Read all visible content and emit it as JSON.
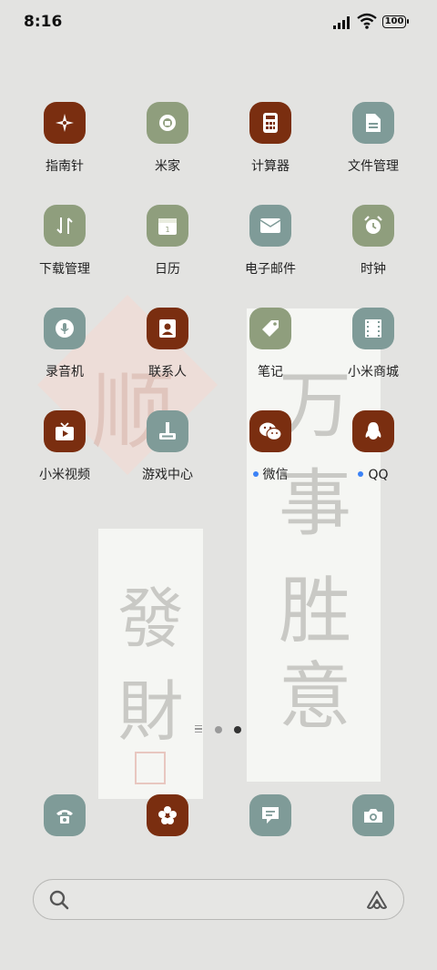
{
  "status_bar": {
    "time": "8:16",
    "battery": "100"
  },
  "wallpaper": {
    "diamond_char": "顺",
    "scroll_right_chars": [
      "万",
      "事",
      "胜",
      "意"
    ],
    "scroll_left_chars": [
      "發",
      "財"
    ]
  },
  "apps": [
    {
      "label": "指南针",
      "icon": "compass-icon",
      "color": "#7a2e10",
      "dot": false
    },
    {
      "label": "米家",
      "icon": "mijia-icon",
      "color": "#8f9e7d",
      "dot": false
    },
    {
      "label": "计算器",
      "icon": "calculator-icon",
      "color": "#7a2e10",
      "dot": false
    },
    {
      "label": "文件管理",
      "icon": "file-icon",
      "color": "#7f9b98",
      "dot": false
    },
    {
      "label": "下载管理",
      "icon": "download-icon",
      "color": "#8f9e7d",
      "dot": false
    },
    {
      "label": "日历",
      "icon": "calendar-icon",
      "color": "#8f9e7d",
      "dot": false
    },
    {
      "label": "电子邮件",
      "icon": "mail-icon",
      "color": "#7f9b98",
      "dot": false
    },
    {
      "label": "时钟",
      "icon": "alarm-clock-icon",
      "color": "#8f9e7d",
      "dot": false
    },
    {
      "label": "录音机",
      "icon": "microphone-icon",
      "color": "#7f9b98",
      "dot": false
    },
    {
      "label": "联系人",
      "icon": "contacts-icon",
      "color": "#7a2e10",
      "dot": false
    },
    {
      "label": "笔记",
      "icon": "tag-icon",
      "color": "#8f9e7d",
      "dot": false
    },
    {
      "label": "小米商城",
      "icon": "film-store-icon",
      "color": "#7f9b98",
      "dot": false
    },
    {
      "label": "小米视频",
      "icon": "tv-icon",
      "color": "#7a2e10",
      "dot": false
    },
    {
      "label": "游戏中心",
      "icon": "joystick-icon",
      "color": "#7f9b98",
      "dot": false
    },
    {
      "label": "微信",
      "icon": "wechat-icon",
      "color": "#7a2e10",
      "dot": true
    },
    {
      "label": "QQ",
      "icon": "qq-penguin-icon",
      "color": "#7a2e10",
      "dot": true
    }
  ],
  "page_indicator": {
    "pages": 2,
    "current": 2
  },
  "dock": [
    {
      "icon": "phone-icon",
      "color": "#7f9b98"
    },
    {
      "icon": "gallery-flower-icon",
      "color": "#7a2e10"
    },
    {
      "icon": "message-icon",
      "color": "#7f9b98"
    },
    {
      "icon": "camera-icon",
      "color": "#7f9b98"
    }
  ],
  "search": {
    "placeholder": ""
  }
}
